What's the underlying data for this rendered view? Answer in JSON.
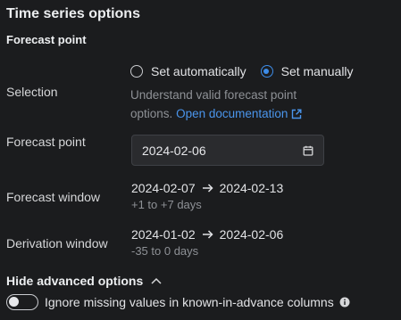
{
  "panel": {
    "title": "Time series options",
    "section_title": "Forecast point"
  },
  "selection": {
    "label": "Selection",
    "options": [
      {
        "label": "Set automatically",
        "checked": false
      },
      {
        "label": "Set manually",
        "checked": true
      }
    ],
    "help_text": "Understand valid forecast point options.",
    "help_link": "Open documentation"
  },
  "forecast_point": {
    "label": "Forecast point",
    "value": "2024-02-06"
  },
  "forecast_window": {
    "label": "Forecast window",
    "start": "2024-02-07",
    "end": "2024-02-13",
    "sub": "+1 to +7 days"
  },
  "derivation_window": {
    "label": "Derivation window",
    "start": "2024-01-02",
    "end": "2024-02-06",
    "sub": "-35 to 0 days"
  },
  "advanced": {
    "toggle_label": "Hide advanced options",
    "ignore_missing": {
      "label": "Ignore missing values in known-in-advance columns",
      "enabled": false
    }
  },
  "colors": {
    "background": "#1b1c1e",
    "accent": "#3d8ce8",
    "link": "#4a95ec",
    "muted_text": "#8e9196"
  }
}
